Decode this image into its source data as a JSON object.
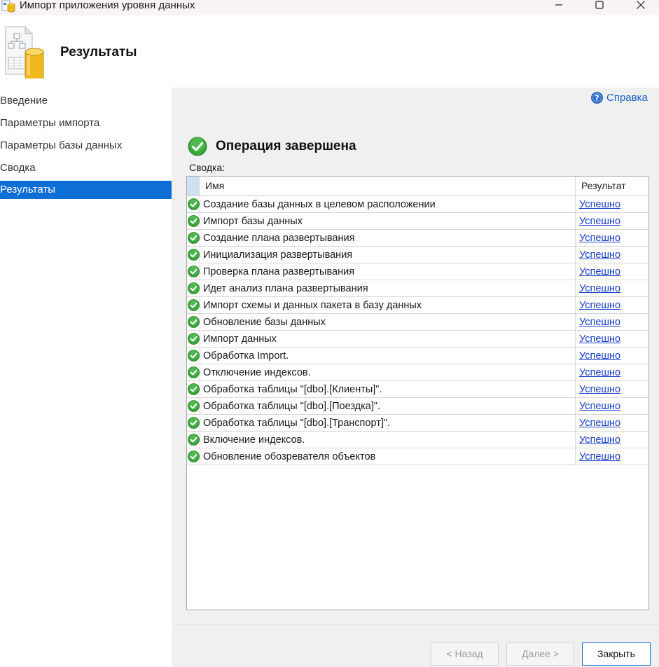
{
  "window": {
    "title": "Импорт приложения уровня данных"
  },
  "header": {
    "title": "Результаты"
  },
  "sidebar": {
    "items": [
      {
        "label": "Введение",
        "active": false
      },
      {
        "label": "Параметры импорта",
        "active": false
      },
      {
        "label": "Параметры базы данных",
        "active": false
      },
      {
        "label": "Сводка",
        "active": false
      },
      {
        "label": "Результаты",
        "active": true
      }
    ]
  },
  "help": {
    "label": "Справка",
    "icon": "help-icon"
  },
  "status": {
    "text": "Операция завершена",
    "icon": "success-check-icon"
  },
  "summary": {
    "label": "Сводка:",
    "columns": {
      "name": "Имя",
      "result": "Результат"
    },
    "rows": [
      {
        "name": "Создание базы данных в целевом расположении",
        "result": "Успешно"
      },
      {
        "name": "Импорт базы данных",
        "result": "Успешно"
      },
      {
        "name": "Создание плана развертывания",
        "result": "Успешно"
      },
      {
        "name": "Инициализация развертывания",
        "result": "Успешно"
      },
      {
        "name": "Проверка плана развертывания",
        "result": "Успешно"
      },
      {
        "name": "Идет анализ плана развертывания",
        "result": "Успешно"
      },
      {
        "name": "Импорт схемы и данных пакета в базу данных",
        "result": "Успешно"
      },
      {
        "name": "Обновление базы данных",
        "result": "Успешно"
      },
      {
        "name": "Импорт данных",
        "result": "Успешно"
      },
      {
        "name": "Обработка Import.",
        "result": "Успешно"
      },
      {
        "name": "Отключение индексов.",
        "result": "Успешно"
      },
      {
        "name": "Обработка таблицы \"[dbo].[Клиенты]\".",
        "result": "Успешно"
      },
      {
        "name": "Обработка таблицы \"[dbo].[Поездка]\".",
        "result": "Успешно"
      },
      {
        "name": "Обработка таблицы \"[dbo].[Транспорт]\".",
        "result": "Успешно"
      },
      {
        "name": "Включение индексов.",
        "result": "Успешно"
      },
      {
        "name": "Обновление обозревателя объектов",
        "result": "Успешно"
      }
    ]
  },
  "footer": {
    "back_label": "< Назад",
    "next_label": "Далее >",
    "close_label": "Закрыть"
  },
  "colors": {
    "accent": "#0d6fd6",
    "link": "#1a40c8",
    "success": "#3aa53a"
  }
}
